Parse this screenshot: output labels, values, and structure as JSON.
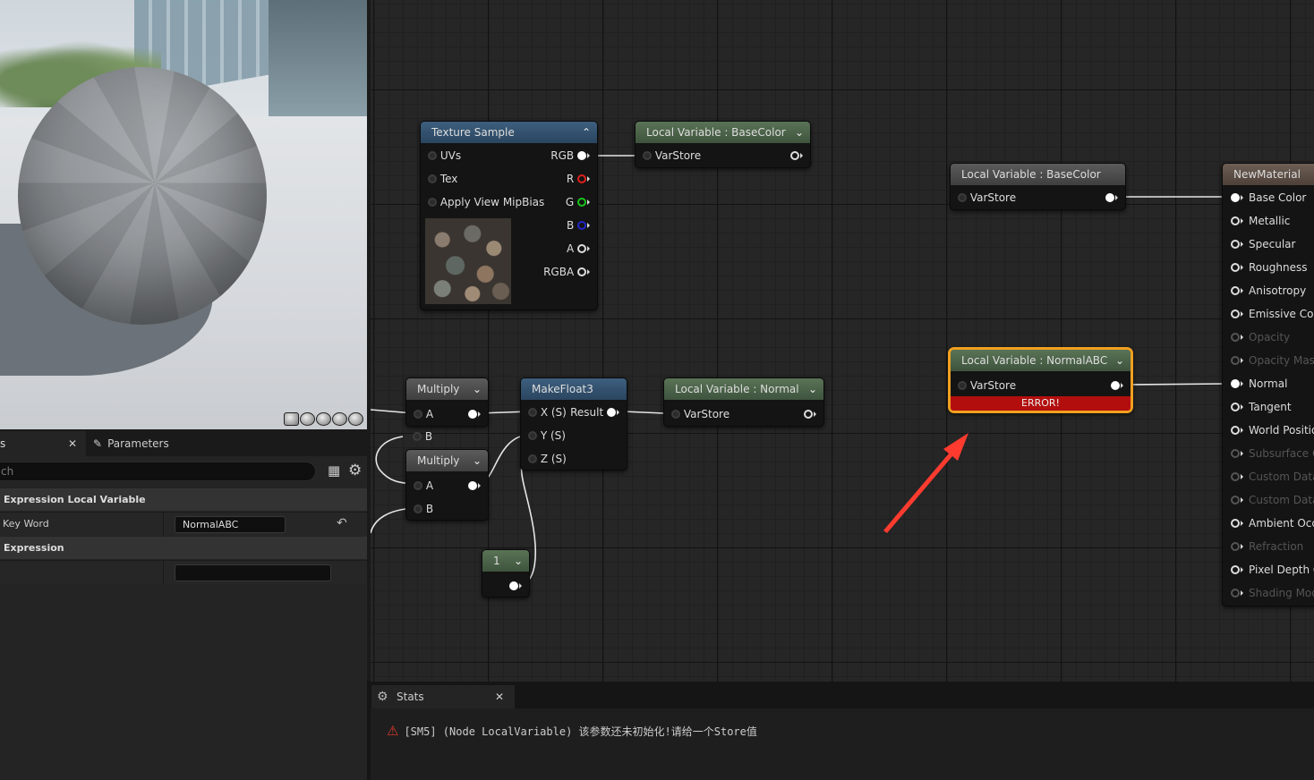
{
  "details": {
    "tab_details_label": "s",
    "tab_details_close": "✕",
    "tab_params_label": "Parameters",
    "search_placeholder": "ch",
    "category_local_variable": "Expression Local Variable",
    "key_word_label": "Key Word",
    "key_word_value": "NormalABC",
    "category_expression": "Expression",
    "expression_value": ""
  },
  "viewport": {
    "preview_shapes": [
      "cylinder",
      "sphere",
      "plane",
      "cube",
      "custom"
    ]
  },
  "nodes": {
    "texture_sample": {
      "title": "Texture Sample",
      "inputs": [
        "UVs",
        "Tex",
        "Apply View MipBias"
      ],
      "outputs": [
        "RGB",
        "R",
        "G",
        "B",
        "A",
        "RGBA"
      ]
    },
    "lv_basecolor_store": {
      "title": "Local Variable : BaseColor",
      "pin": "VarStore"
    },
    "lv_basecolor_read": {
      "title": "Local Variable : BaseColor",
      "pin": "VarStore"
    },
    "new_material": {
      "title": "NewMaterial",
      "pins": [
        "Base Color",
        "Metallic",
        "Specular",
        "Roughness",
        "Anisotropy",
        "Emissive Colo",
        "Opacity",
        "Opacity Mask",
        "Normal",
        "Tangent",
        "World Position",
        "Subsurface Co",
        "Custom Data",
        "Custom Data",
        "Ambient Occlu",
        "Refraction",
        "Pixel Depth Of",
        "Shading Mode"
      ]
    },
    "lv_normalabc": {
      "title": "Local Variable : NormalABC",
      "pin": "VarStore",
      "error": "ERROR!"
    },
    "multiply_1": {
      "title": "Multiply",
      "pin_a": "A",
      "pin_b": "B"
    },
    "multiply_2": {
      "title": "Multiply",
      "pin_a": "A",
      "pin_b": "B"
    },
    "makefloat3": {
      "title": "MakeFloat3",
      "pin_x": "X (S)",
      "result": "Result",
      "pin_y": "Y (S)",
      "pin_z": "Z (S)"
    },
    "lv_normal": {
      "title": "Local Variable : Normal",
      "pin": "VarStore"
    },
    "constant": {
      "title": "1"
    }
  },
  "stats": {
    "tab_label": "Stats",
    "close": "✕",
    "message": "[SM5] (Node LocalVariable) 该参数还未初始化!请给一个Store值"
  },
  "colors": {
    "error_highlight": "#f0a020",
    "arrow": "#ff3b2f",
    "error_bar": "#b30e0e"
  }
}
